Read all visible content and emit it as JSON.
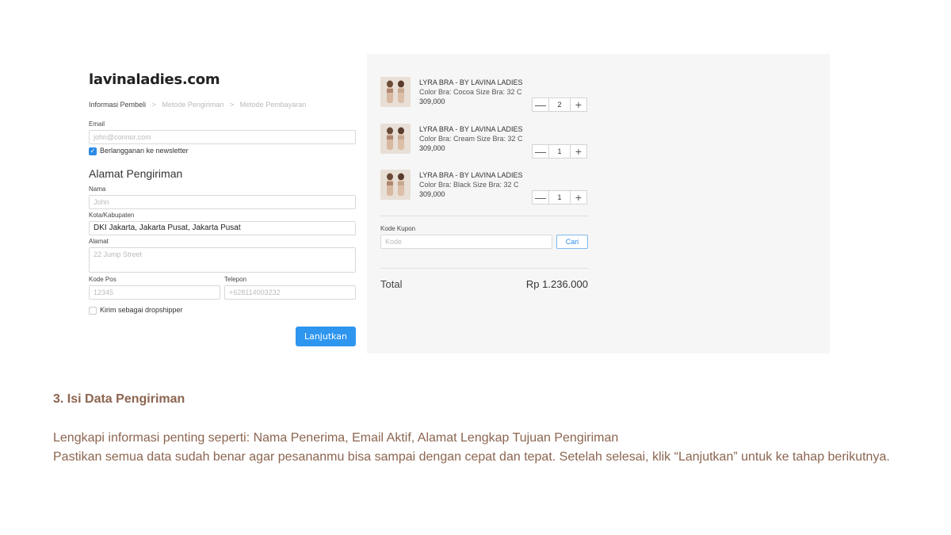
{
  "store": {
    "brand": "lavinaladies.com"
  },
  "breadcrumb": {
    "steps": [
      "Informasi Pembeli",
      "Metode Pengiriman",
      "Metode Pembayaran"
    ],
    "separator": ">"
  },
  "form": {
    "email_label": "Email",
    "email_placeholder": "john@connor.com",
    "newsletter_label": "Berlangganan ke newsletter",
    "newsletter_checked": true,
    "section_title": "Alamat Pengiriman",
    "name_label": "Nama",
    "name_placeholder": "John",
    "city_label": "Kota/Kabupaten",
    "city_value": "DKI Jakarta, Jakarta Pusat, Jakarta Pusat",
    "address_label": "Alamat",
    "address_placeholder": "22 Jump Street",
    "postal_label": "Kode Pos",
    "postal_placeholder": "12345",
    "phone_label": "Telepon",
    "phone_placeholder": "+628114003232",
    "dropship_label": "Kirim sebagai dropshipper",
    "dropship_checked": false,
    "continue_label": "Lanjutkan"
  },
  "cart": {
    "items": [
      {
        "name": "LYRA BRA - BY LAVINA LADIES",
        "meta": "Color Bra: Cocoa  Size Bra: 32 C",
        "price": "309,000",
        "qty": "2"
      },
      {
        "name": "LYRA BRA - BY LAVINA LADIES",
        "meta": "Color Bra: Cream  Size Bra: 32 C",
        "price": "309,000",
        "qty": "1"
      },
      {
        "name": "LYRA BRA - BY LAVINA LADIES",
        "meta": "Color Bra: Black  Size Bra: 32 C",
        "price": "309,000",
        "qty": "1"
      }
    ],
    "minus_symbol": "—",
    "plus_symbol": "+",
    "coupon_label": "Kode Kupon",
    "coupon_placeholder": "Kode",
    "coupon_button": "Cari",
    "total_label": "Total",
    "total_value": "Rp 1.236.000"
  },
  "caption": {
    "title": "3. Isi Data Pengiriman",
    "line1": "Lengkapi informasi penting seperti: Nama Penerima, Email Aktif, Alamat Lengkap Tujuan Pengiriman",
    "line2": "Pastikan semua data sudah benar agar pesananmu bisa sampai dengan cepat dan tepat. Setelah selesai, klik “Lanjutkan” untuk ke tahap berikutnya."
  },
  "colors": {
    "accent": "#2f96f0",
    "caption_brown": "#8c6550",
    "panel_bg": "#f6f6f6"
  },
  "icons": {
    "checkbox": "check-icon",
    "product_photo": "product-thumbnail"
  }
}
